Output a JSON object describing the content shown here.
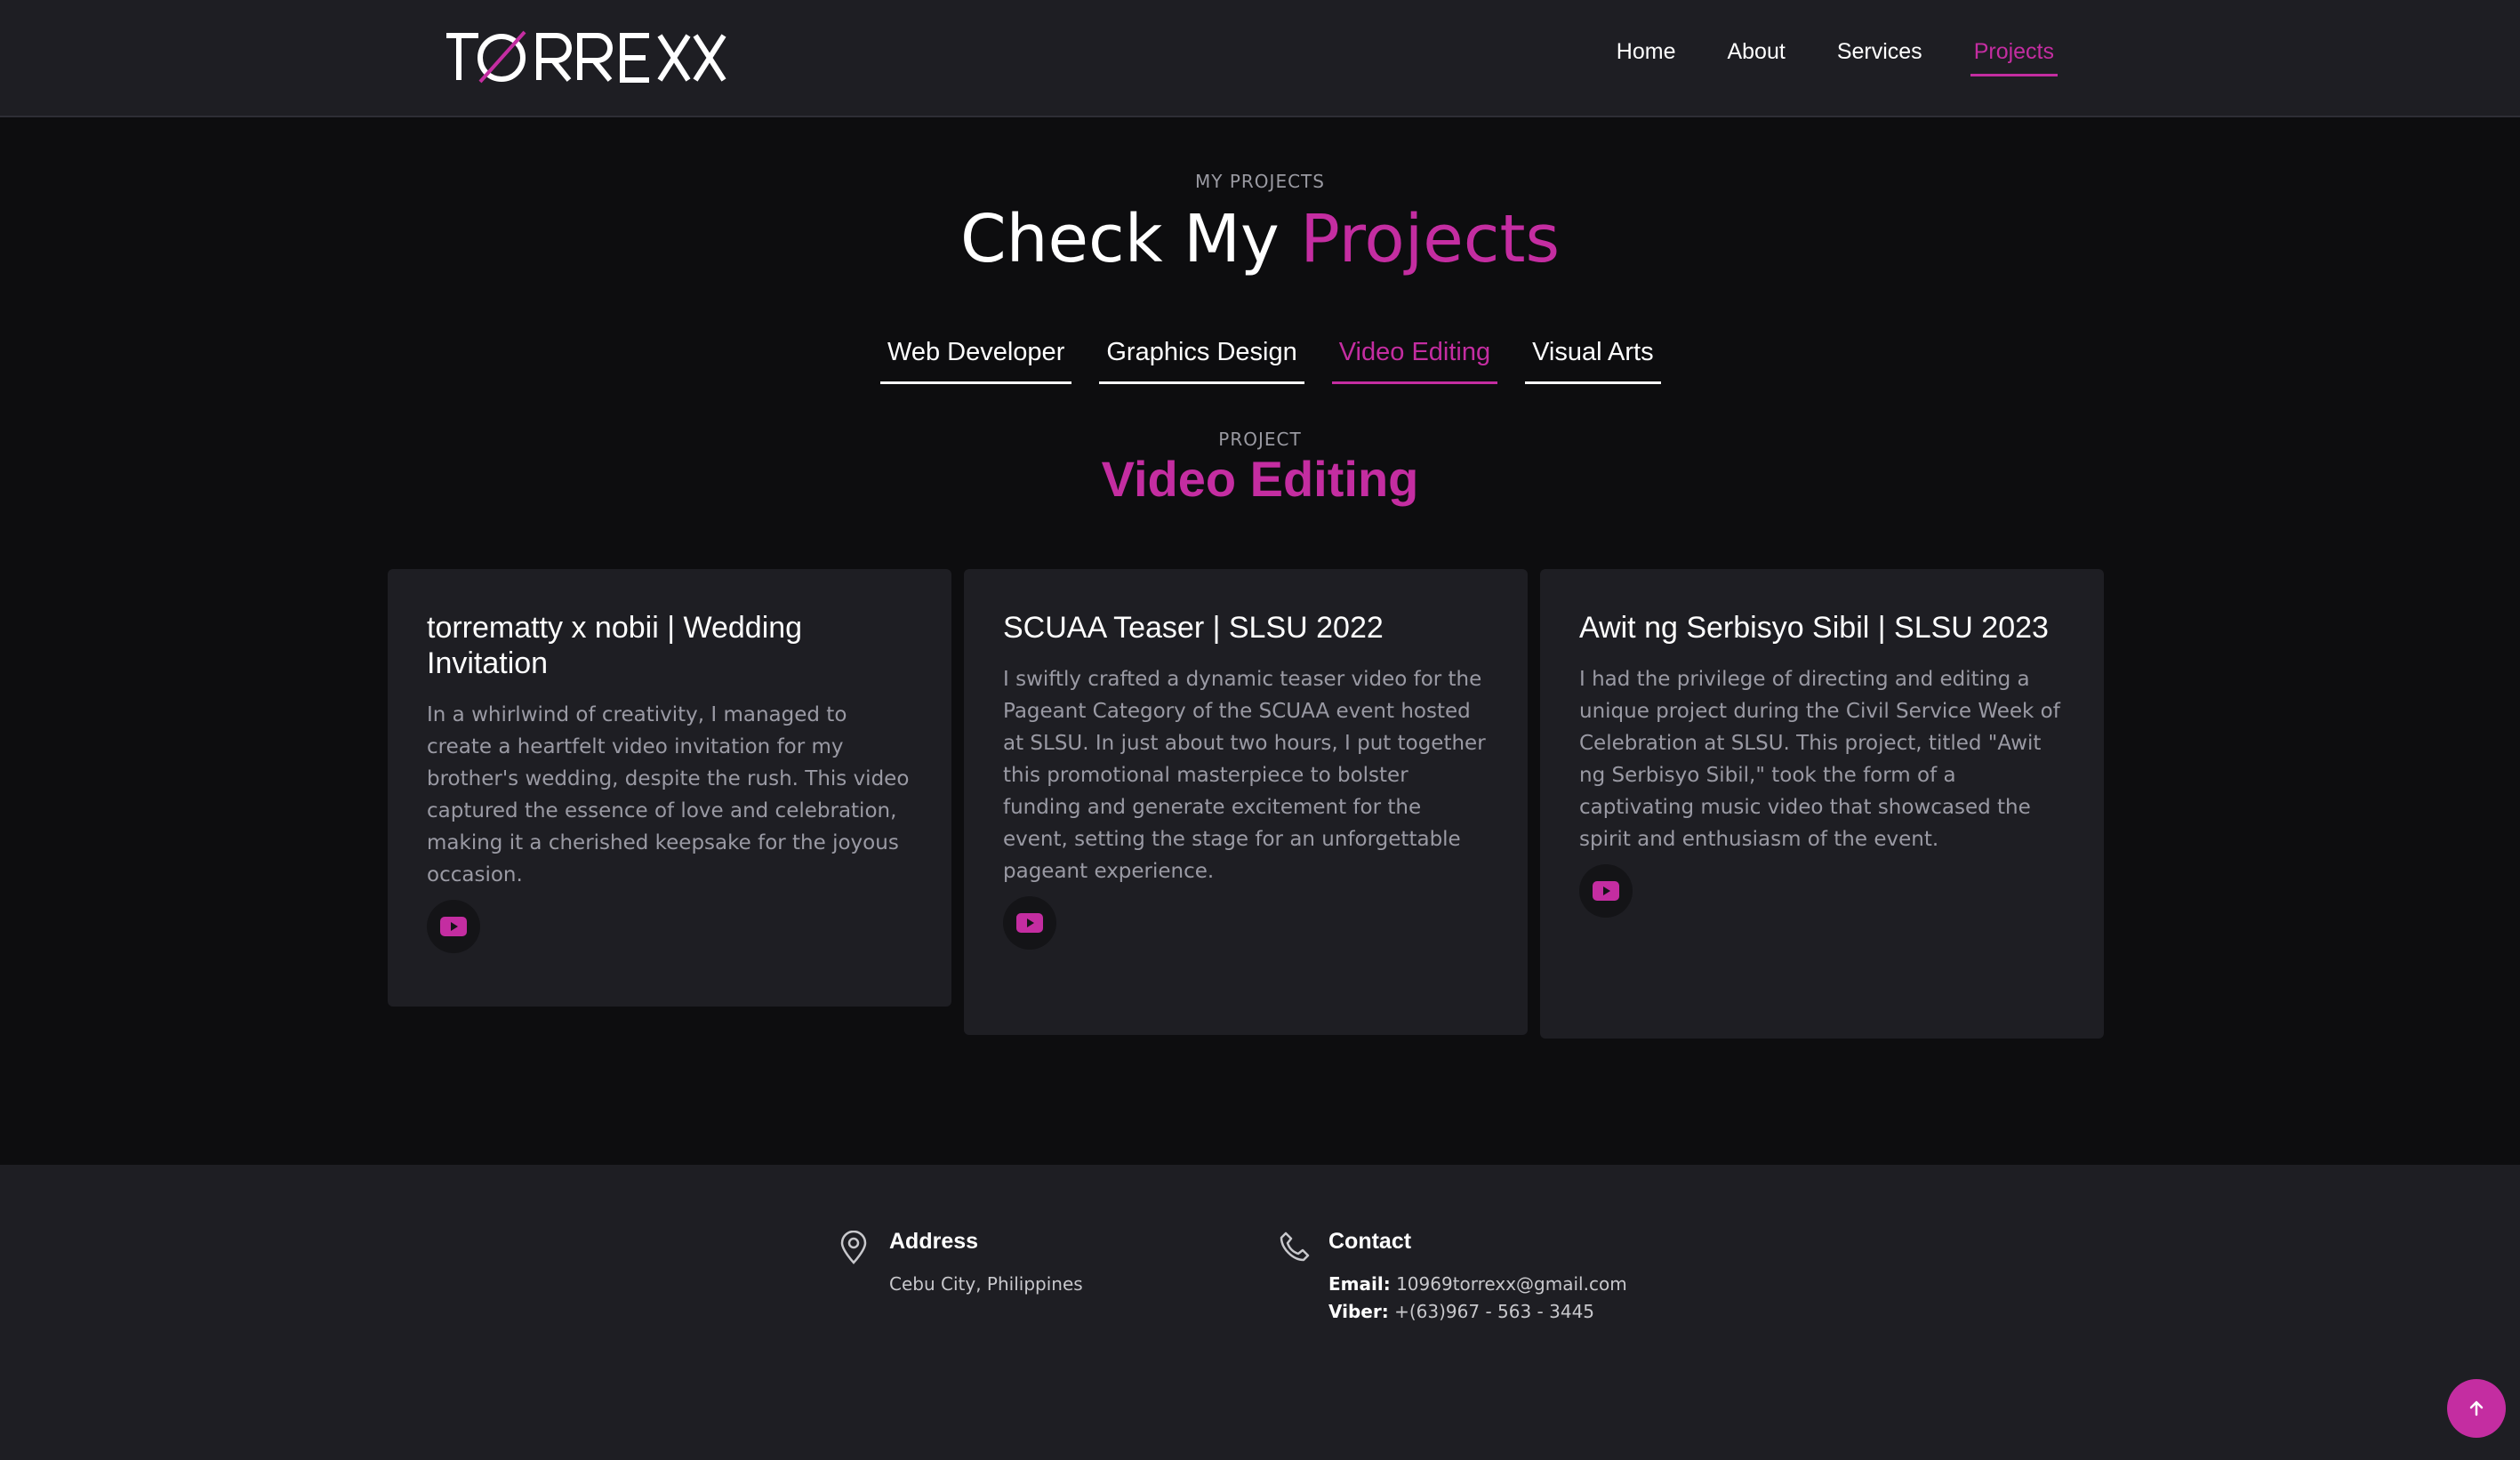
{
  "brand": {
    "logo_text": "TORREXX"
  },
  "nav": {
    "items": [
      {
        "label": "Home",
        "active": false
      },
      {
        "label": "About",
        "active": false
      },
      {
        "label": "Services",
        "active": false
      },
      {
        "label": "Projects",
        "active": true
      }
    ]
  },
  "section": {
    "subtitle": "MY PROJECTS",
    "title_prefix": "Check My",
    "title_accent": "Projects"
  },
  "tabs": [
    {
      "label": "Web Developer",
      "active": false
    },
    {
      "label": "Graphics Design",
      "active": false
    },
    {
      "label": "Video Editing",
      "active": true
    },
    {
      "label": "Visual Arts",
      "active": false
    }
  ],
  "category": {
    "subtitle": "PROJECT",
    "title": "Video Editing"
  },
  "cards": [
    {
      "title": "torrematty x nobii | Wedding Invitation",
      "description": "In a whirlwind of creativity, I managed to create a heartfelt video invitation for my brother's wedding, despite the rush. This video captured the essence of love and celebration, making it a cherished keepsake for the joyous occasion.",
      "icon": "youtube-icon"
    },
    {
      "title": "SCUAA Teaser | SLSU 2022",
      "description": "I swiftly crafted a dynamic teaser video for the Pageant Category of the SCUAA event hosted at SLSU. In just about two hours, I put together this promotional masterpiece to bolster funding and generate excitement for the event, setting the stage for an unforgettable pageant experience.",
      "icon": "youtube-icon"
    },
    {
      "title": "Awit ng Serbisyo Sibil | SLSU 2023",
      "description": "I had the privilege of directing and editing a unique project during the Civil Service Week of Celebration at SLSU. This project, titled \"Awit ng Serbisyo Sibil,\" took the form of a captivating music video that showcased the spirit and enthusiasm of the event.",
      "icon": "youtube-icon"
    }
  ],
  "footer": {
    "address": {
      "heading": "Address",
      "value": "Cebu City, Philippines",
      "icon": "map-pin-icon"
    },
    "contact": {
      "heading": "Contact",
      "icon": "phone-icon",
      "email_label": "Email:",
      "email": "10969torrexx@gmail.com",
      "viber_label": "Viber:",
      "viber": "+(63)967 - 563 - 3445"
    }
  },
  "back_to_top": {
    "icon": "arrow-up-icon"
  },
  "colors": {
    "accent": "#c42da1",
    "background": "#0d0d0f",
    "panel": "#1e1e23",
    "muted_text": "#9a9aa4"
  }
}
